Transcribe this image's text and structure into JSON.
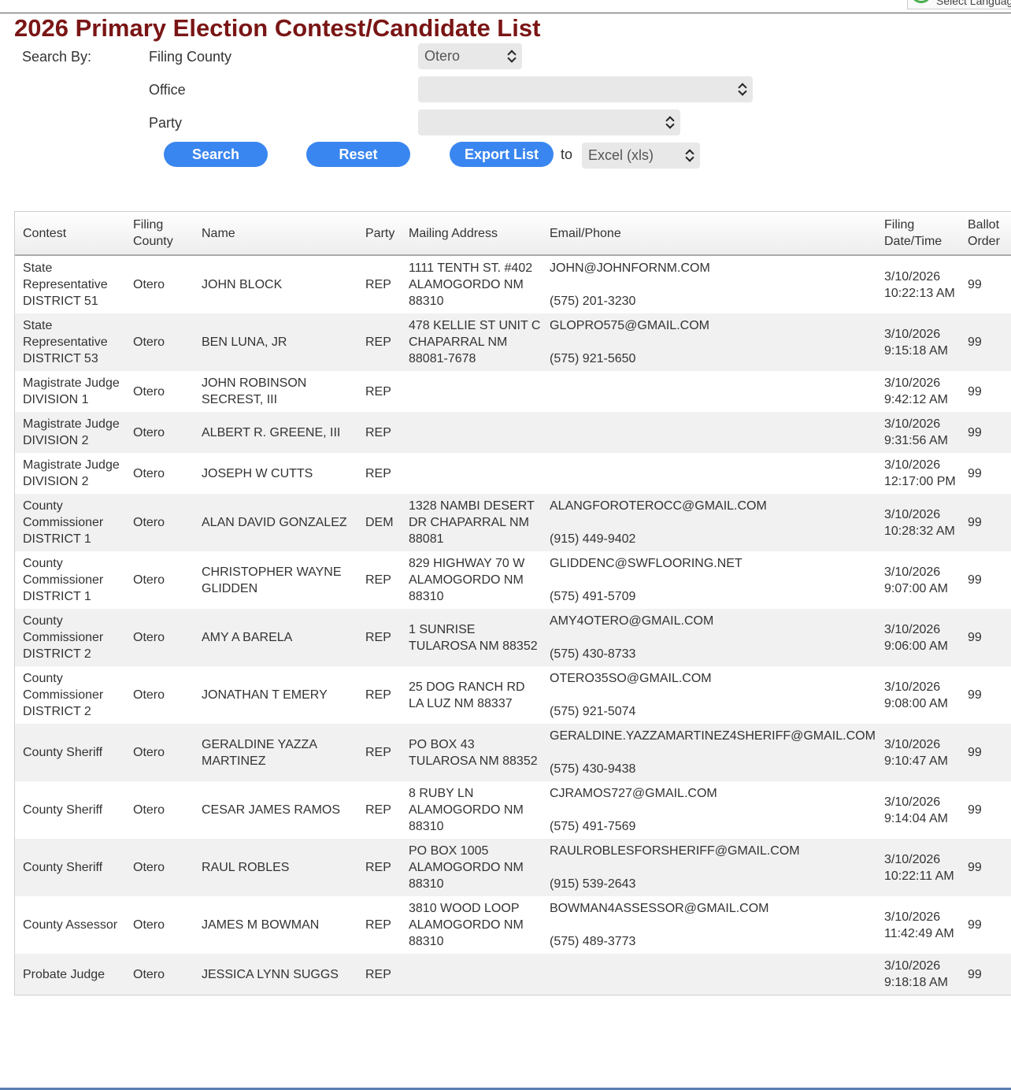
{
  "language_widget": "Select Language",
  "title": "2026 Primary Election Contest/Candidate List",
  "search": {
    "search_by_label": "Search By:",
    "filing_county_label": "Filing County",
    "filing_county_value": "Otero",
    "office_label": "Office",
    "office_value": "",
    "party_label": "Party",
    "party_value": "",
    "search_button": "Search",
    "reset_button": "Reset",
    "export_button": "Export List",
    "to_label": "to",
    "export_format": "Excel (xls)"
  },
  "table": {
    "headers": [
      "Contest",
      "Filing County",
      "Name",
      "Party",
      "Mailing Address",
      "Email/Phone",
      "Filing Date/Time",
      "Ballot Order"
    ],
    "rows": [
      {
        "contest": "State Representative DISTRICT 51",
        "county": "Otero",
        "name": "JOHN BLOCK",
        "party": "REP",
        "address": "1111 TENTH ST. #402 ALAMOGORDO NM 88310",
        "email": "JOHN@JOHNFORNM.COM",
        "phone": "(575) 201-3230",
        "filed": "3/10/2026 10:22:13 AM",
        "ballot": "99"
      },
      {
        "contest": "State Representative DISTRICT 53",
        "county": "Otero",
        "name": "BEN LUNA, JR",
        "party": "REP",
        "address": "478 KELLIE ST UNIT C CHAPARRAL NM 88081-7678",
        "email": "GLOPRO575@GMAIL.COM",
        "phone": "(575) 921-5650",
        "filed": "3/10/2026 9:15:18 AM",
        "ballot": "99"
      },
      {
        "contest": "Magistrate Judge DIVISION 1",
        "county": "Otero",
        "name": "JOHN ROBINSON SECREST, III",
        "party": "REP",
        "address": "",
        "email": "",
        "phone": "",
        "filed": "3/10/2026 9:42:12 AM",
        "ballot": "99"
      },
      {
        "contest": "Magistrate Judge DIVISION 2",
        "county": "Otero",
        "name": "ALBERT R. GREENE, III",
        "party": "REP",
        "address": "",
        "email": "",
        "phone": "",
        "filed": "3/10/2026 9:31:56 AM",
        "ballot": "99"
      },
      {
        "contest": "Magistrate Judge DIVISION 2",
        "county": "Otero",
        "name": "JOSEPH W CUTTS",
        "party": "REP",
        "address": "",
        "email": "",
        "phone": "",
        "filed": "3/10/2026 12:17:00 PM",
        "ballot": "99"
      },
      {
        "contest": "County Commissioner DISTRICT 1",
        "county": "Otero",
        "name": "ALAN DAVID GONZALEZ",
        "party": "DEM",
        "address": "1328 NAMBI DESERT DR CHAPARRAL NM 88081",
        "email": "ALANGFOROTEROCC@GMAIL.COM",
        "phone": "(915) 449-9402",
        "filed": "3/10/2026 10:28:32 AM",
        "ballot": "99"
      },
      {
        "contest": "County Commissioner DISTRICT 1",
        "county": "Otero",
        "name": "CHRISTOPHER WAYNE GLIDDEN",
        "party": "REP",
        "address": "829 HIGHWAY 70 W ALAMOGORDO NM 88310",
        "email": "GLIDDENC@SWFLOORING.NET",
        "phone": "(575) 491-5709",
        "filed": "3/10/2026 9:07:00 AM",
        "ballot": "99"
      },
      {
        "contest": "County Commissioner DISTRICT 2",
        "county": "Otero",
        "name": "AMY A BARELA",
        "party": "REP",
        "address": "1 SUNRISE TULAROSA NM 88352",
        "email": "AMY4OTERO@GMAIL.COM",
        "phone": "(575) 430-8733",
        "filed": "3/10/2026 9:06:00 AM",
        "ballot": "99"
      },
      {
        "contest": "County Commissioner DISTRICT 2",
        "county": "Otero",
        "name": "JONATHAN T EMERY",
        "party": "REP",
        "address": "25 DOG RANCH RD LA LUZ NM 88337",
        "email": "OTERO35SO@GMAIL.COM",
        "phone": "(575) 921-5074",
        "filed": "3/10/2026 9:08:00 AM",
        "ballot": "99"
      },
      {
        "contest": "County Sheriff",
        "county": "Otero",
        "name": "GERALDINE YAZZA MARTINEZ",
        "party": "REP",
        "address": "PO BOX 43 TULAROSA NM 88352",
        "email": "GERALDINE.YAZZAMARTINEZ4SHERIFF@GMAIL.COM",
        "phone": "(575) 430-9438",
        "filed": "3/10/2026 9:10:47 AM",
        "ballot": "99"
      },
      {
        "contest": "County Sheriff",
        "county": "Otero",
        "name": "CESAR JAMES RAMOS",
        "party": "REP",
        "address": "8 RUBY LN ALAMOGORDO NM 88310",
        "email": "CJRAMOS727@GMAIL.COM",
        "phone": "(575) 491-7569",
        "filed": "3/10/2026 9:14:04 AM",
        "ballot": "99"
      },
      {
        "contest": "County Sheriff",
        "county": "Otero",
        "name": "RAUL ROBLES",
        "party": "REP",
        "address": "PO BOX 1005 ALAMOGORDO NM 88310",
        "email": "RAULROBLESFORSHERIFF@GMAIL.COM",
        "phone": "(915) 539-2643",
        "filed": "3/10/2026 10:22:11 AM",
        "ballot": "99"
      },
      {
        "contest": "County Assessor",
        "county": "Otero",
        "name": "JAMES M BOWMAN",
        "party": "REP",
        "address": "3810 WOOD LOOP ALAMOGORDO NM 88310",
        "email": "BOWMAN4ASSESSOR@GMAIL.COM",
        "phone": "(575) 489-3773",
        "filed": "3/10/2026 11:42:49 AM",
        "ballot": "99"
      },
      {
        "contest": "Probate Judge",
        "county": "Otero",
        "name": "JESSICA LYNN SUGGS",
        "party": "REP",
        "address": "",
        "email": "",
        "phone": "",
        "filed": "3/10/2026 9:18:18 AM",
        "ballot": "99"
      }
    ]
  },
  "colors": {
    "title": "#7a1515",
    "button": "#3a86f0",
    "row_alt": "#f1f1f1"
  }
}
